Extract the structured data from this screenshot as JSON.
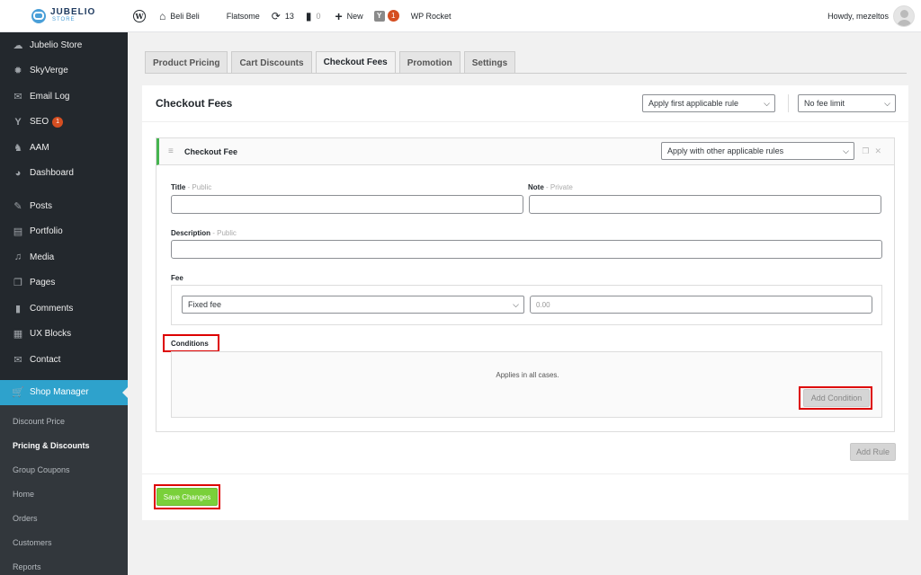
{
  "topbar": {
    "logo_main": "JUBELIO",
    "logo_sub": "STORE",
    "wp_logo": "W",
    "site_name": "Beli Beli",
    "theme": "Flatsome",
    "updates_count": "13",
    "comments_count": "0",
    "new_label": "New",
    "yoast_letter": "Y",
    "yoast_badge": "1",
    "rocket_label": "WP Rocket",
    "howdy": "Howdy, mezeltos"
  },
  "sidebar": {
    "items": [
      {
        "label": "Jubelio Store",
        "icon": "jubelio-icon"
      },
      {
        "label": "SkyVerge",
        "icon": "gear-icon"
      },
      {
        "label": "Email Log",
        "icon": "mail-icon"
      },
      {
        "label": "SEO",
        "icon": "yoast-icon",
        "badge": "1"
      },
      {
        "label": "AAM",
        "icon": "wolf-icon"
      },
      {
        "label": "Dashboard",
        "icon": "dashboard-icon"
      },
      {
        "label": "Posts",
        "icon": "pin-icon"
      },
      {
        "label": "Portfolio",
        "icon": "portfolio-icon"
      },
      {
        "label": "Media",
        "icon": "media-icon"
      },
      {
        "label": "Pages",
        "icon": "pages-icon"
      },
      {
        "label": "Comments",
        "icon": "comment-icon"
      },
      {
        "label": "UX Blocks",
        "icon": "blocks-icon"
      },
      {
        "label": "Contact",
        "icon": "mail-icon"
      },
      {
        "label": "Shop Manager",
        "icon": "cart-icon"
      }
    ],
    "submenu": [
      "Discount Price",
      "Pricing & Discounts",
      "Group Coupons",
      "Home",
      "Orders",
      "Customers",
      "Reports"
    ]
  },
  "tabs": [
    "Product Pricing",
    "Cart Discounts",
    "Checkout Fees",
    "Promotion",
    "Settings"
  ],
  "panel": {
    "title": "Checkout Fees",
    "rule_mode": "Apply first applicable rule",
    "fee_limit": "No fee limit",
    "rule": {
      "title": "Checkout Fee",
      "apply_mode": "Apply with other applicable rules",
      "title_label": "Title",
      "title_hint": "- Public",
      "note_label": "Note",
      "note_hint": "- Private",
      "description_label": "Description",
      "description_hint": "- Public",
      "fee_label": "Fee",
      "fee_type": "Fixed fee",
      "fee_placeholder": "0.00",
      "conditions_label": "Conditions",
      "conditions_text": "Applies in all cases.",
      "add_condition": "Add Condition"
    },
    "add_rule": "Add Rule",
    "save": "Save Changes"
  },
  "colors": {
    "sidebar_bg": "#23282d",
    "active_blue": "#2ea2cc",
    "save_green": "#7ad03a",
    "highlight_red": "#dd0000",
    "rule_accent": "#46b450"
  }
}
